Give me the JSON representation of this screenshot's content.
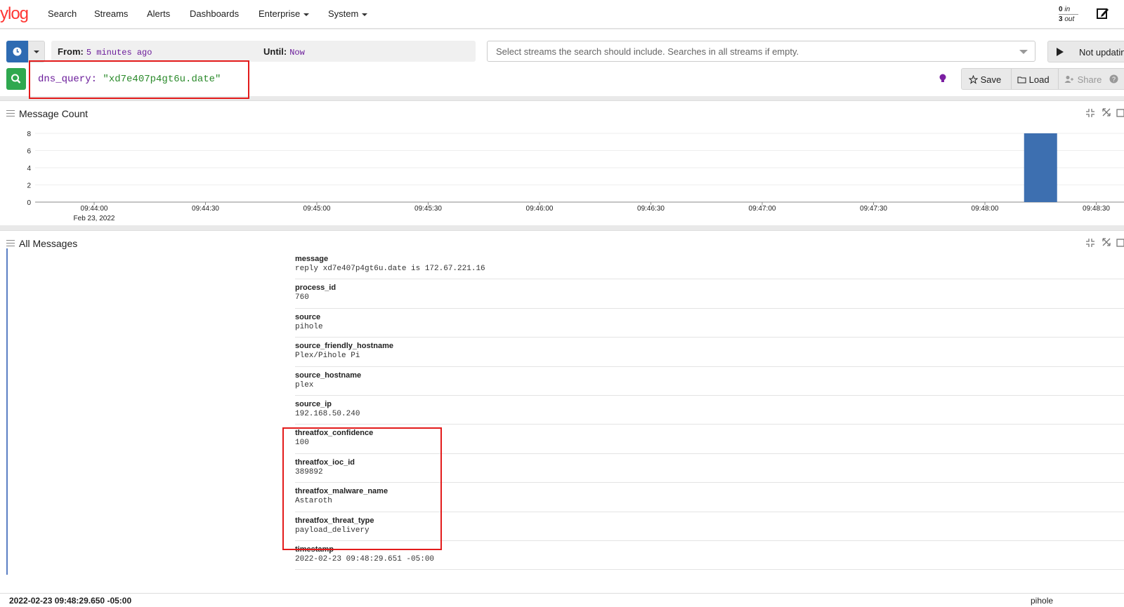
{
  "nav": {
    "logo": "ylog",
    "items": [
      "Search",
      "Streams",
      "Alerts",
      "Dashboards",
      "Enterprise",
      "System"
    ],
    "throughput_in_count": "0",
    "throughput_in_label": "in",
    "throughput_out_count": "3",
    "throughput_out_label": "out"
  },
  "search": {
    "from_label": "From:",
    "from_value": "5 minutes ago",
    "until_label": "Until:",
    "until_value": "Now",
    "streams_placeholder": "Select streams the search should include. Searches in all streams if empty.",
    "refresh_label": "Not updating",
    "query_field": "dns_query:",
    "query_value": "\"xd7e407p4gt6u.date\"",
    "save_label": "Save",
    "load_label": "Load",
    "share_label": "Share"
  },
  "message_count": {
    "title": "Message Count"
  },
  "chart_data": {
    "type": "bar",
    "title": "Message Count",
    "x_ticks": [
      "09:44:00",
      "09:44:30",
      "09:45:00",
      "09:45:30",
      "09:46:00",
      "09:46:30",
      "09:47:00",
      "09:47:30",
      "09:48:00",
      "09:48:30"
    ],
    "x_date_label": "Feb 23, 2022",
    "y_ticks": [
      0,
      2,
      4,
      6,
      8
    ],
    "ylim": [
      0,
      8
    ],
    "bars": [
      {
        "x": "09:48:15",
        "value": 8
      }
    ],
    "bar_color": "#3d6fb0",
    "grid": true
  },
  "all_messages": {
    "title": "All Messages",
    "fields": [
      {
        "name": "message",
        "value": "reply xd7e407p4gt6u.date is 172.67.221.16"
      },
      {
        "name": "process_id",
        "value": "760"
      },
      {
        "name": "source",
        "value": "pihole"
      },
      {
        "name": "source_friendly_hostname",
        "value": "Plex/Pihole Pi"
      },
      {
        "name": "source_hostname",
        "value": "plex"
      },
      {
        "name": "source_ip",
        "value": "192.168.50.240"
      },
      {
        "name": "threatfox_confidence",
        "value": "100"
      },
      {
        "name": "threatfox_ioc_id",
        "value": "389892"
      },
      {
        "name": "threatfox_malware_name",
        "value": "Astaroth"
      },
      {
        "name": "threatfox_threat_type",
        "value": "payload_delivery"
      },
      {
        "name": "timestamp",
        "value": "2022-02-23 09:48:29.651 -05:00"
      }
    ],
    "next_row_timestamp": "2022-02-23 09:48:29.650 -05:00",
    "next_row_source": "pihole"
  }
}
